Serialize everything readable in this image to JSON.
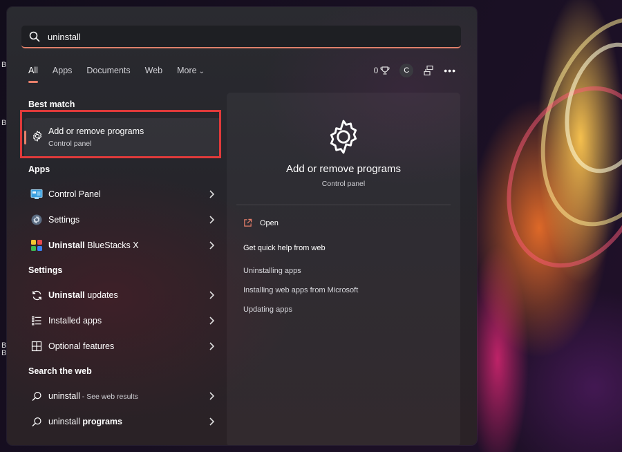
{
  "search": {
    "value": "uninstall",
    "placeholder": ""
  },
  "tabs": [
    {
      "label": "All",
      "active": true
    },
    {
      "label": "Apps"
    },
    {
      "label": "Documents"
    },
    {
      "label": "Web"
    },
    {
      "label": "More"
    }
  ],
  "header": {
    "points": "0",
    "avatar_letter": "C"
  },
  "best_match": {
    "section": "Best match",
    "title": "Add or remove programs",
    "subtitle": "Control panel"
  },
  "apps": {
    "section": "Apps",
    "items": [
      {
        "label": "Control Panel"
      },
      {
        "label": "Settings"
      },
      {
        "bold": "Uninstall",
        "rest": " BlueStacks X"
      }
    ]
  },
  "settings": {
    "section": "Settings",
    "items": [
      {
        "bold": "Uninstall",
        "rest": " updates"
      },
      {
        "label": "Installed apps"
      },
      {
        "label": "Optional features"
      }
    ]
  },
  "web": {
    "section": "Search the web",
    "items": [
      {
        "label": "uninstall",
        "muted": " - See web results"
      },
      {
        "label": "uninstall ",
        "bold": "programs"
      }
    ]
  },
  "details": {
    "title": "Add or remove programs",
    "subtitle": "Control panel",
    "open_label": "Open",
    "help_title": "Get quick help from web",
    "links": [
      "Uninstalling apps",
      "Installing web apps from Microsoft",
      "Updating apps"
    ]
  },
  "desktop_letters": [
    "B",
    "B",
    "B",
    "B"
  ],
  "colors": {
    "accent": "#e8806b",
    "highlight": "#e03a3a"
  }
}
